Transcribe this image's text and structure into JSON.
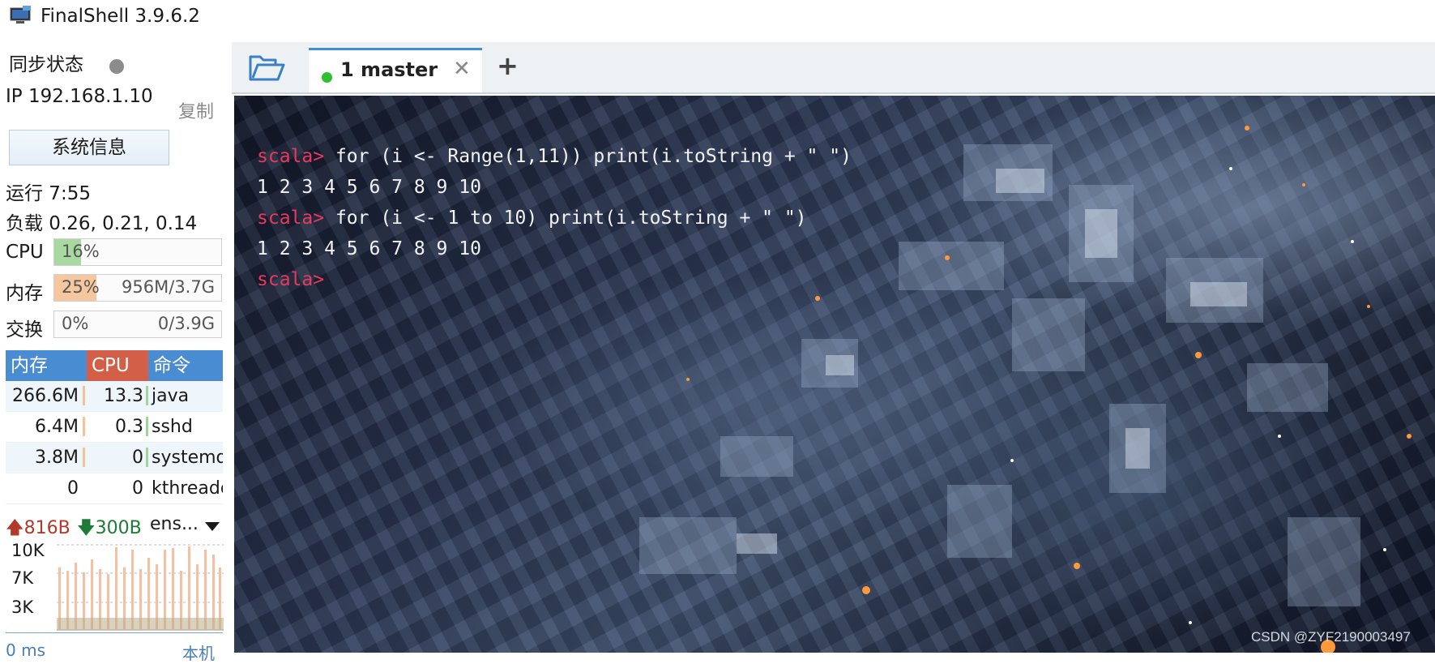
{
  "window": {
    "title": "FinalShell 3.9.6.2"
  },
  "sidebar": {
    "sync_label": "同步状态",
    "ip_label": "IP 192.168.1.10",
    "copy_label": "复制",
    "sysinfo_button": "系统信息",
    "uptime": "运行 7:55",
    "load": "负载 0.26, 0.21, 0.14",
    "meters": {
      "cpu": {
        "label": "CPU",
        "percent": "16%",
        "amount": "",
        "fill": 0.16,
        "color": "#a8d9a0"
      },
      "mem": {
        "label": "内存",
        "percent": "25%",
        "amount": "956M/3.7G",
        "fill": 0.25,
        "color": "#f6c79e"
      },
      "swap": {
        "label": "交换",
        "percent": "0%",
        "amount": "0/3.9G",
        "fill": 0.0,
        "color": "#cfe0ef"
      }
    },
    "process_table": {
      "headers": {
        "mem": "内存",
        "cpu": "CPU",
        "cmd": "命令"
      },
      "rows": [
        {
          "mem": "266.6M",
          "cpu": "13.3",
          "cmd": "java"
        },
        {
          "mem": "6.4M",
          "cpu": "0.3",
          "cmd": "sshd"
        },
        {
          "mem": "3.8M",
          "cpu": "0",
          "cmd": "systemd"
        },
        {
          "mem": "0",
          "cpu": "0",
          "cmd": "kthreadd"
        }
      ]
    },
    "network": {
      "up": "816B",
      "down": "300B",
      "interface": "ens...",
      "axis": [
        "10K",
        "7K",
        "3K"
      ],
      "bottom_left": "0 ms",
      "bottom_right": "本机"
    }
  },
  "tabs": [
    {
      "label": "1 master",
      "status_color": "#2ec02e",
      "active": true
    }
  ],
  "terminal": {
    "lines": [
      {
        "prompt": "scala>",
        "text": " for (i <- Range(1,11)) print(i.toString + \" \")"
      },
      {
        "prompt": "",
        "text": "1 2 3 4 5 6 7 8 9 10"
      },
      {
        "prompt": "scala>",
        "text": " for (i <- 1 to 10) print(i.toString + \" \")"
      },
      {
        "prompt": "",
        "text": "1 2 3 4 5 6 7 8 9 10"
      },
      {
        "prompt": "scala>",
        "text": ""
      }
    ]
  },
  "watermark": "CSDN @ZYF2190003497"
}
